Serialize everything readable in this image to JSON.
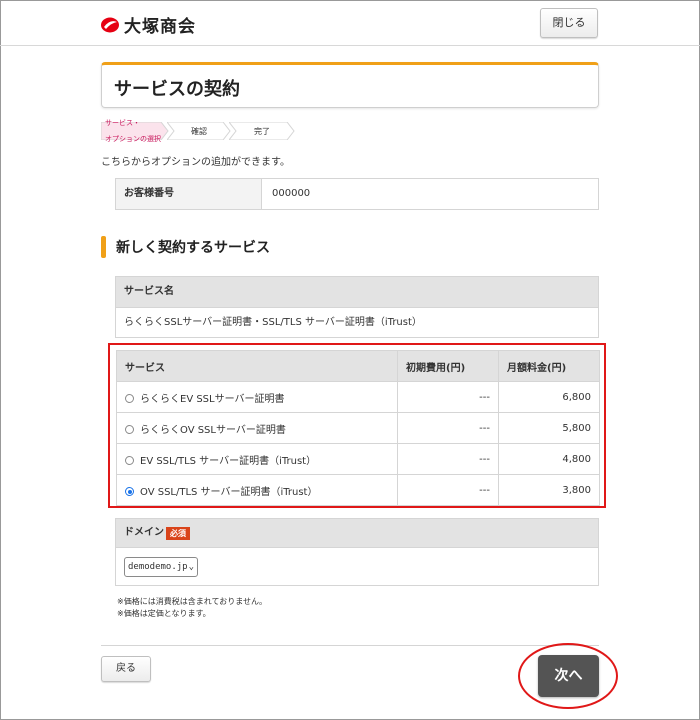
{
  "header": {
    "logo_text": "大塚商会",
    "close_label": "閉じる"
  },
  "page": {
    "title": "サービスの契約",
    "description": "こちらからオプションの追加ができます。"
  },
  "steps": [
    {
      "label_line1": "サービス・",
      "label_line2": "オプションの選択",
      "active": true
    },
    {
      "label": "確認",
      "active": false
    },
    {
      "label": "完了",
      "active": false
    }
  ],
  "customer": {
    "label": "お客様番号",
    "value": "000000"
  },
  "section": {
    "title": "新しく契約するサービス"
  },
  "service_name": {
    "header": "サービス名",
    "value": "らくらくSSLサーバー証明書・SSL/TLS サーバー証明書（iTrust）"
  },
  "service_table": {
    "headers": [
      "サービス",
      "初期費用(円)",
      "月額料金(円)"
    ],
    "rows": [
      {
        "name": "らくらくEV SSLサーバー証明書",
        "initial": "---",
        "monthly": "6,800",
        "selected": false
      },
      {
        "name": "らくらくOV SSLサーバー証明書",
        "initial": "---",
        "monthly": "5,800",
        "selected": false
      },
      {
        "name": "EV SSL/TLS サーバー証明書（iTrust）",
        "initial": "---",
        "monthly": "4,800",
        "selected": false
      },
      {
        "name": "OV SSL/TLS サーバー証明書（iTrust）",
        "initial": "---",
        "monthly": "3,800",
        "selected": true
      }
    ]
  },
  "domain": {
    "label": "ドメイン",
    "required_label": "必須",
    "selected": "demodemo.jp"
  },
  "notes": [
    "※価格には消費税は含まれておりません。",
    "※価格は定価となります。"
  ],
  "footer": {
    "back_label": "戻る",
    "next_label": "次へ"
  },
  "colors": {
    "accent": "#f0a018",
    "highlight": "#e01818",
    "primary_button": "#545454",
    "required_badge": "#d9441a",
    "logo_red": "#e60012"
  }
}
